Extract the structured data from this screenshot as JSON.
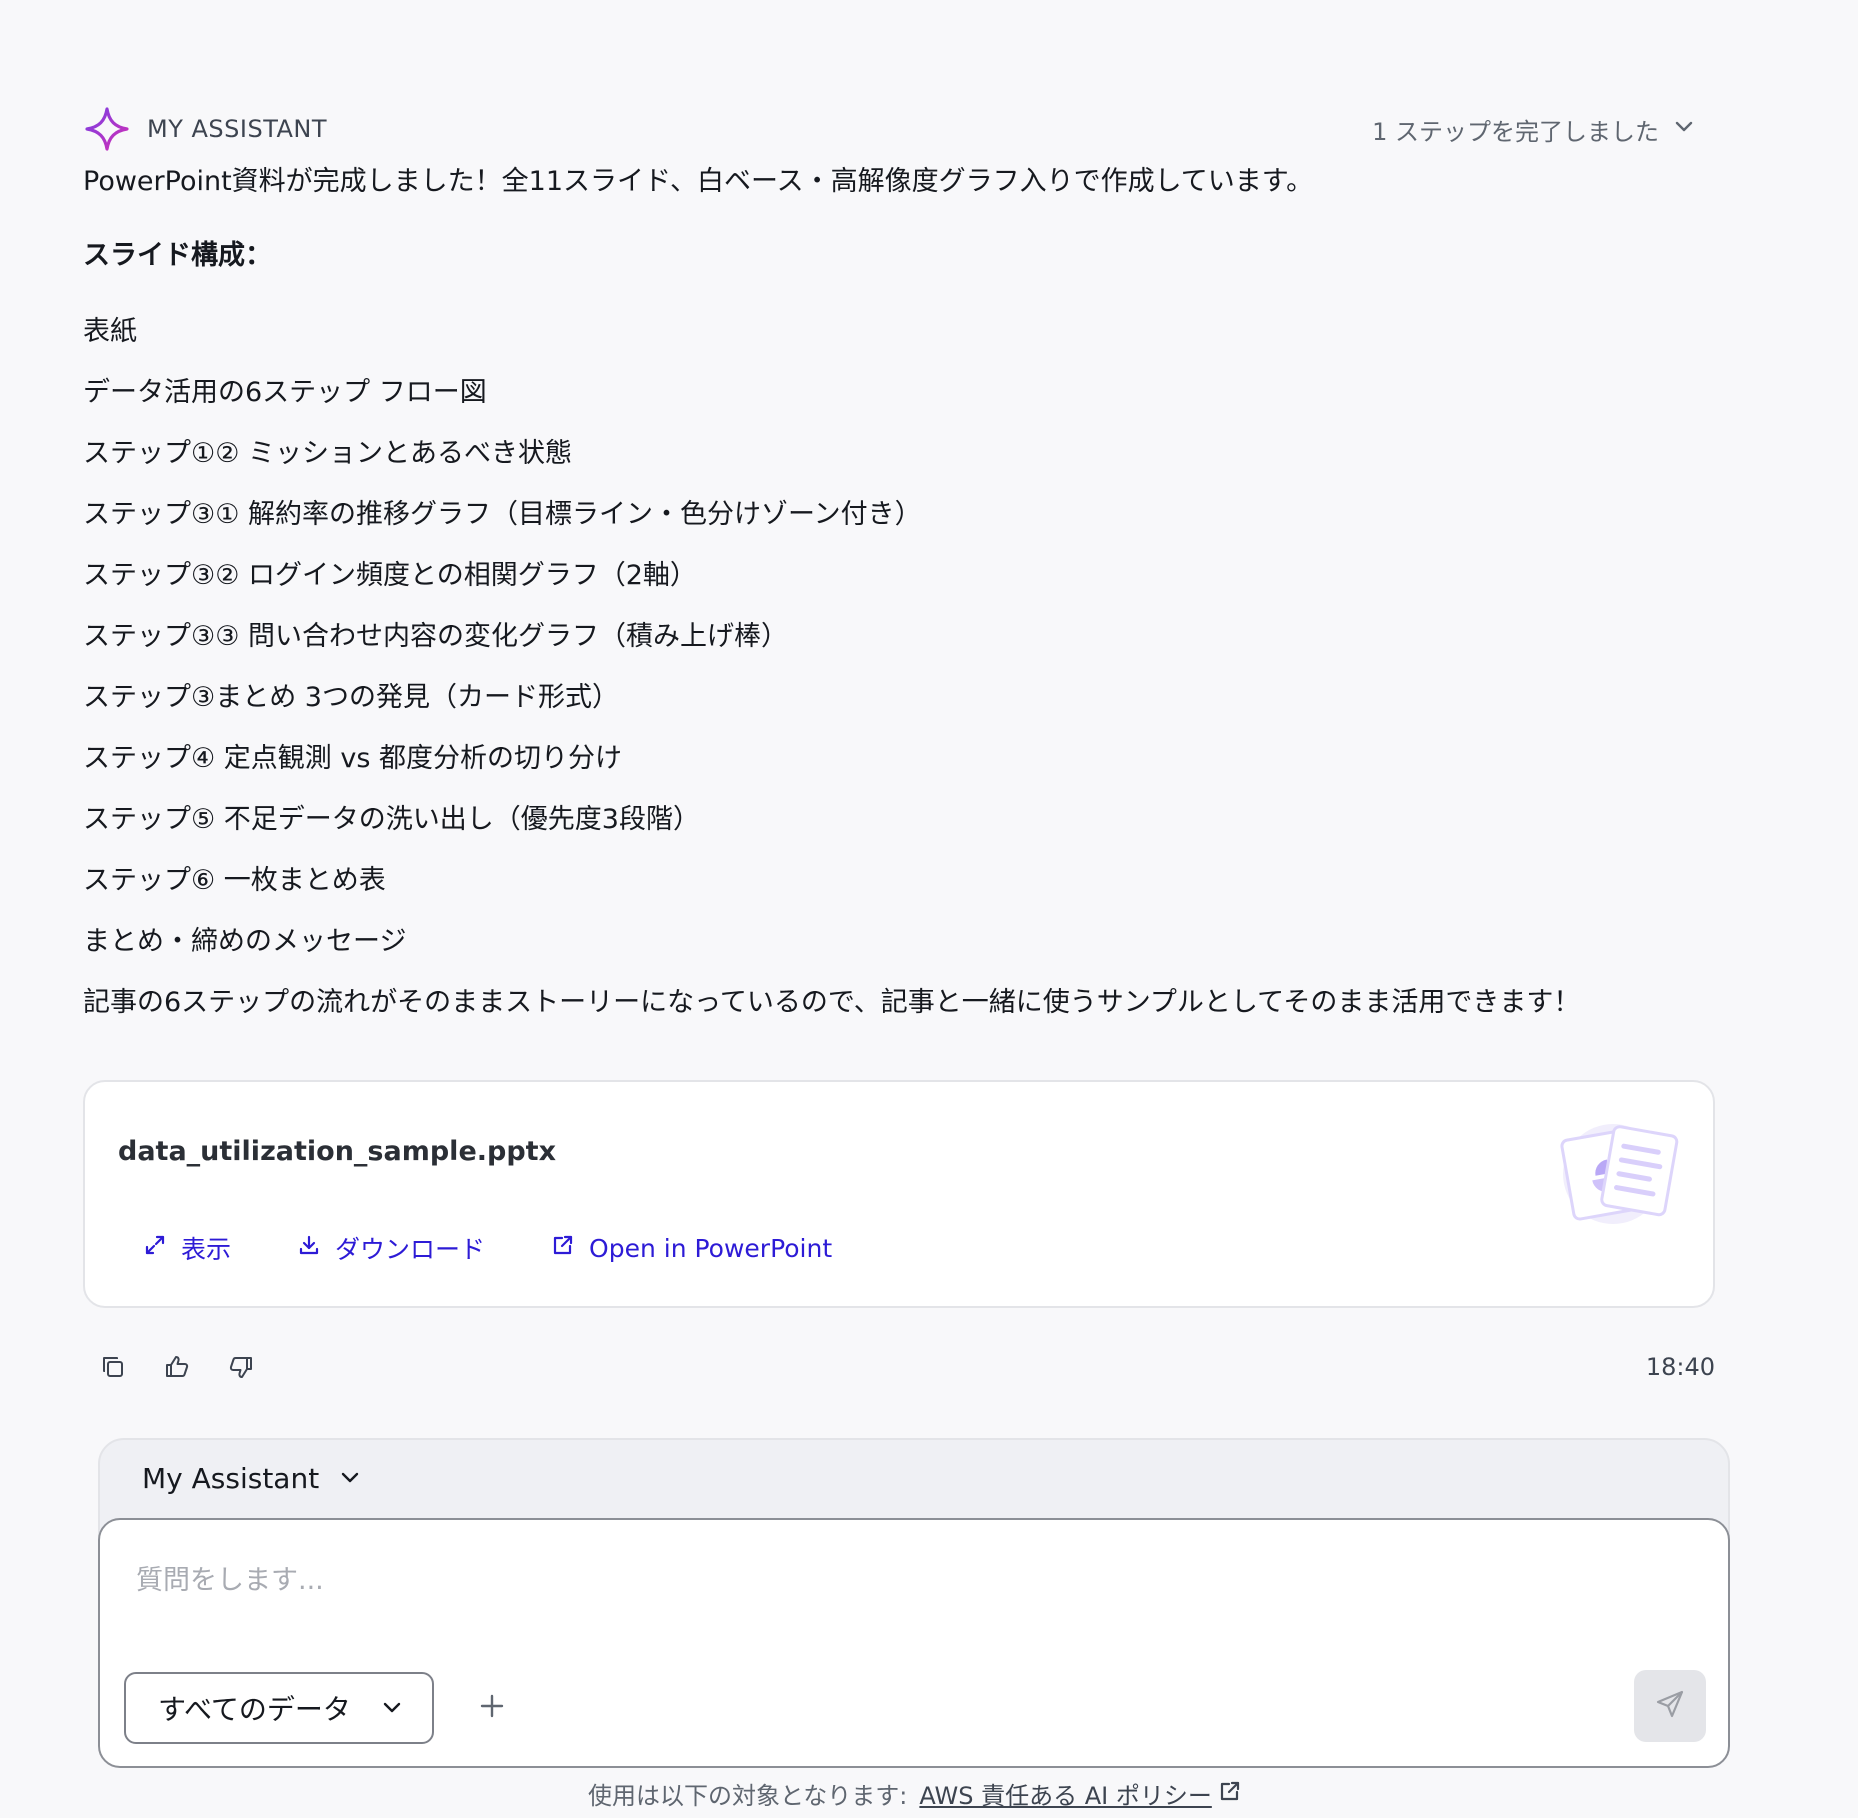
{
  "assistant": {
    "name": "MY ASSISTANT",
    "steps_label": "1 ステップを完了しました"
  },
  "message": {
    "intro": "PowerPoint資料が完成しました！全11スライド、白ベース・高解像度グラフ入りで作成しています。",
    "heading": "スライド構成：",
    "slides": [
      "表紙",
      "データ活用の6ステップ フロー図",
      "ステップ①② ミッションとあるべき状態",
      "ステップ③① 解約率の推移グラフ（目標ライン・色分けゾーン付き）",
      "ステップ③② ログイン頻度との相関グラフ（2軸）",
      "ステップ③③ 問い合わせ内容の変化グラフ（積み上げ棒）",
      "ステップ③まとめ 3つの発見（カード形式）",
      "ステップ④ 定点観測 vs 都度分析の切り分け",
      "ステップ⑤ 不足データの洗い出し（優先度3段階）",
      "ステップ⑥ 一枚まとめ表",
      "まとめ・締めのメッセージ"
    ],
    "closing": "記事の6ステップの流れがそのままストーリーになっているので、記事と一緒に使うサンプルとしてそのまま活用できます！"
  },
  "file": {
    "name": "data_utilization_sample.pptx",
    "actions": {
      "view": "表示",
      "download": "ダウンロード",
      "open": "Open in PowerPoint"
    }
  },
  "toolbar": {
    "timestamp": "18:40"
  },
  "composer": {
    "model": "My Assistant",
    "placeholder": "質問をします...",
    "value": "",
    "data_scope": "すべてのデータ"
  },
  "footer": {
    "text": "使用は以下の対象となります:",
    "link": "AWS 責任ある AI ポリシー"
  },
  "colors": {
    "accent": "#2d1bd6",
    "logo_gradient_start": "#7b3fe4",
    "logo_gradient_end": "#d12fb5",
    "background": "#f8f8fa"
  },
  "icons": {
    "logo": "sparkle-icon",
    "steps": "chevron-down-icon",
    "view": "expand-icon",
    "download": "download-icon",
    "open": "external-link-icon",
    "copy": "copy-icon",
    "like": "thumbs-up-icon",
    "dislike": "thumbs-down-icon",
    "attach": "plus-icon",
    "send": "send-icon"
  }
}
